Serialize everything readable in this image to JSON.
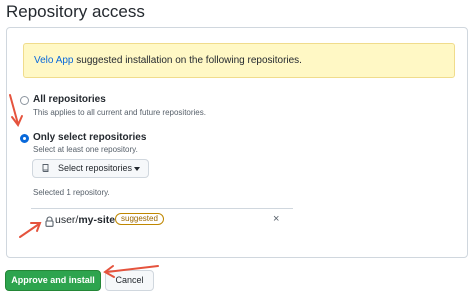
{
  "page": {
    "title": "Repository access"
  },
  "notice": {
    "app_name": "Velo App",
    "message": " suggested installation on the following repositories."
  },
  "options": {
    "all": {
      "label": "All repositories",
      "note": "This applies to all current and future repositories.",
      "selected": false
    },
    "select": {
      "label": "Only select repositories",
      "note": "Select at least one repository.",
      "selected": true
    }
  },
  "select_button": {
    "label": "Select repositories"
  },
  "selection": {
    "count_text": "Selected 1 repository."
  },
  "repo": {
    "owner": "user/",
    "name": "my-site",
    "badge": "suggested",
    "remove": "×"
  },
  "actions": {
    "approve": "Approve and install",
    "cancel": "Cancel"
  },
  "colors": {
    "accent": "#0969da",
    "primary": "#2da44e",
    "annotation": "#e5533d"
  }
}
